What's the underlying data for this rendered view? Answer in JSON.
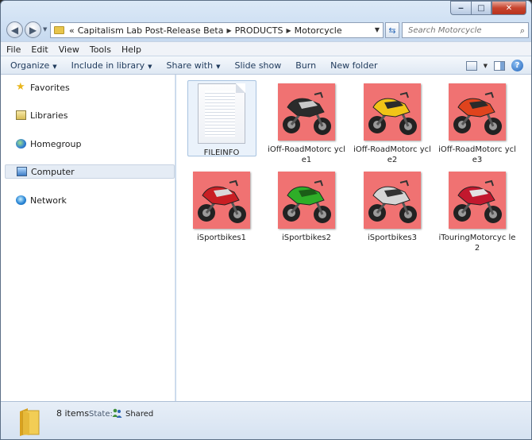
{
  "window": {
    "caption_buttons": [
      "minimize",
      "maximize",
      "close"
    ]
  },
  "address": {
    "overflow": "«",
    "crumbs": [
      "Capitalism Lab Post-Release Beta",
      "PRODUCTS",
      "Motorcycle"
    ]
  },
  "search": {
    "placeholder": "Search Motorcycle"
  },
  "menu": [
    "File",
    "Edit",
    "View",
    "Tools",
    "Help"
  ],
  "toolbar": {
    "organize": "Organize",
    "include": "Include in library",
    "share": "Share with",
    "slideshow": "Slide show",
    "burn": "Burn",
    "new_folder": "New folder"
  },
  "nav": {
    "favorites": "Favorites",
    "libraries": "Libraries",
    "homegroup": "Homegroup",
    "computer": "Computer",
    "network": "Network"
  },
  "files": [
    {
      "name": "FILEINFO",
      "kind": "text-document"
    },
    {
      "name": "iOff-RoadMotorcycle1",
      "kind": "image",
      "bike_color": "#2b2b2b",
      "accent": "#c9c9c9"
    },
    {
      "name": "iOff-RoadMotorcycle2",
      "kind": "image",
      "bike_color": "#f2c417",
      "accent": "#2b2b2b"
    },
    {
      "name": "iOff-RoadMotorcycle3",
      "kind": "image",
      "bike_color": "#e0431d",
      "accent": "#2b2b2b"
    },
    {
      "name": "iSportbikes1",
      "kind": "image",
      "bike_color": "#c91f24",
      "accent": "#d9d9d9"
    },
    {
      "name": "iSportbikes2",
      "kind": "image",
      "bike_color": "#2fae28",
      "accent": "#1b5e17"
    },
    {
      "name": "iSportbikes3",
      "kind": "image",
      "bike_color": "#d6d6d6",
      "accent": "#333333"
    },
    {
      "name": "iTouringMotorcycle2",
      "kind": "image",
      "bike_color": "#c2182e",
      "accent": "#e3e3e3"
    }
  ],
  "labels": {
    "file0": "FILEINFO",
    "file1": "iOff-RoadMotorc ycle1",
    "file2": "iOff-RoadMotorc ycle2",
    "file3": "iOff-RoadMotorc ycle3",
    "file4": "iSportbikes1",
    "file5": "iSportbikes2",
    "file6": "iSportbikes3",
    "file7": "iTouringMotorcyc le2"
  },
  "details": {
    "count": "8 items",
    "state_label": "State:",
    "state_value": "Shared"
  },
  "colors": {
    "thumb_background": "#f07272",
    "selection": "#eaf2fb"
  }
}
